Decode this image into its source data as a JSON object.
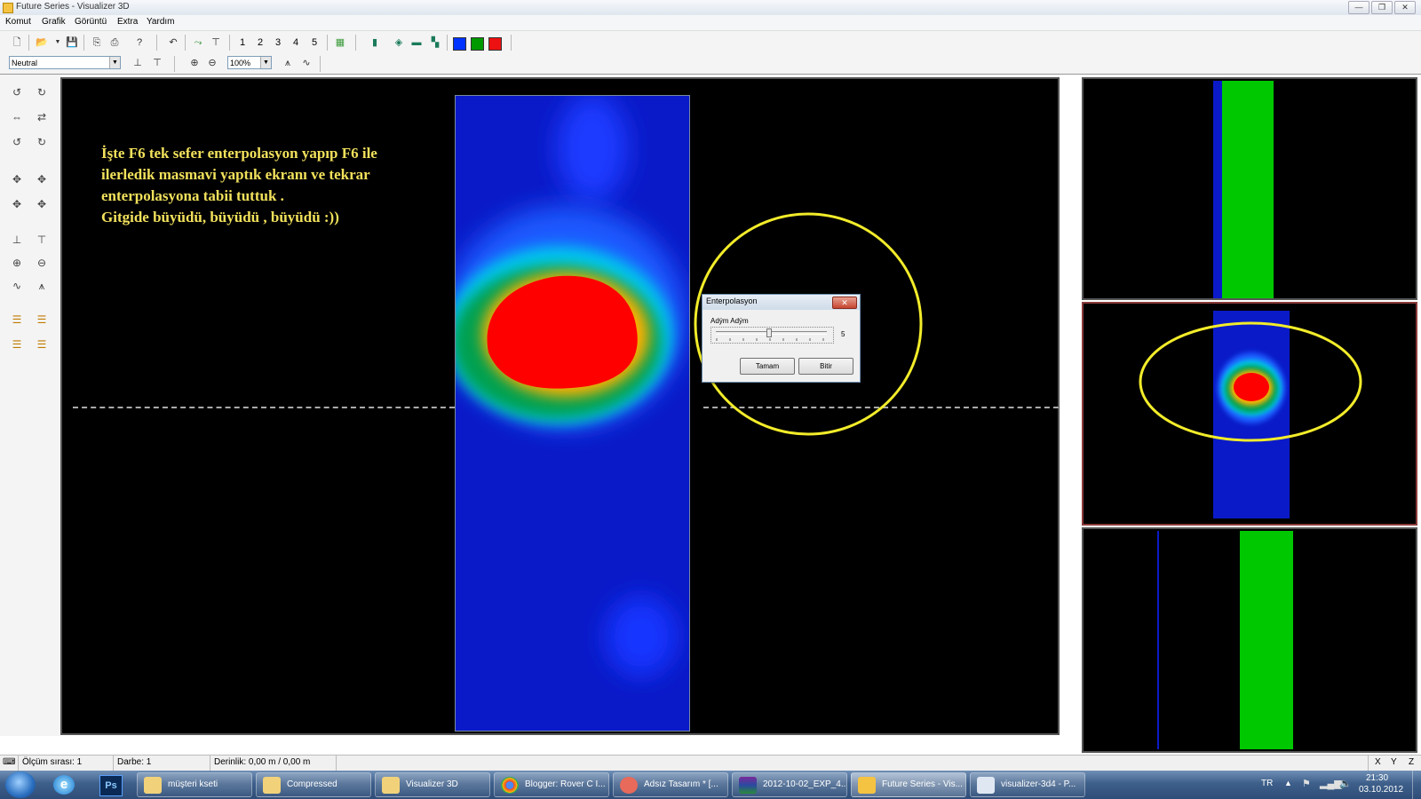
{
  "window": {
    "title": "Future Series - Visualizer 3D",
    "minimize": "—",
    "restore": "❐",
    "close": "✕"
  },
  "menu": [
    "Komut",
    "Grafik",
    "Görüntü",
    "Extra",
    "Yardım"
  ],
  "toolbar": {
    "view_numbers": [
      "1",
      "2",
      "3",
      "4",
      "5"
    ],
    "color_swatches": [
      "#0033ff",
      "#009900",
      "#ee1111"
    ]
  },
  "toolbar2": {
    "mode_select": "Neutral",
    "zoom_select": "100%"
  },
  "annotation": {
    "lines": [
      "İşte F6 tek sefer enterpolasyon yapıp F6 ile",
      "ilerledik masmavi yaptık ekranı ve tekrar",
      "enterpolasyona tabii tuttuk .",
      " Gitgide büyüdü, büyüdü , büyüdü :))"
    ],
    "color": "#f2e15c"
  },
  "dialog": {
    "title": "Enterpolasyon",
    "label": "Adým Adým",
    "slider_value": "5",
    "ok_label": "Tamam",
    "finish_label": "Bitir"
  },
  "status": {
    "measure": "Ölçüm sırası: 1",
    "pulse": "Darbe: 1",
    "depth": "Derinlik: 0,00 m / 0,00 m",
    "axes": [
      "X",
      "Y",
      "Z"
    ]
  },
  "taskbar": {
    "items": [
      {
        "label": "müşteri kseti",
        "icon": "folder-icon"
      },
      {
        "label": "Compressed",
        "icon": "folder-icon"
      },
      {
        "label": "Visualizer 3D",
        "icon": "folder-icon"
      },
      {
        "label": "Blogger: Rover C I...",
        "icon": "chrome-icon"
      },
      {
        "label": "Adsız Tasarım * [...",
        "icon": "app-icon"
      },
      {
        "label": "2012-10-02_EXP_4...",
        "icon": "winrar-icon"
      },
      {
        "label": "Future Series - Vis...",
        "icon": "future-series-icon"
      },
      {
        "label": "visualizer-3d4 - P...",
        "icon": "paint-icon"
      }
    ],
    "lang": "TR",
    "time": "21:30",
    "date": "03.10.2012"
  }
}
